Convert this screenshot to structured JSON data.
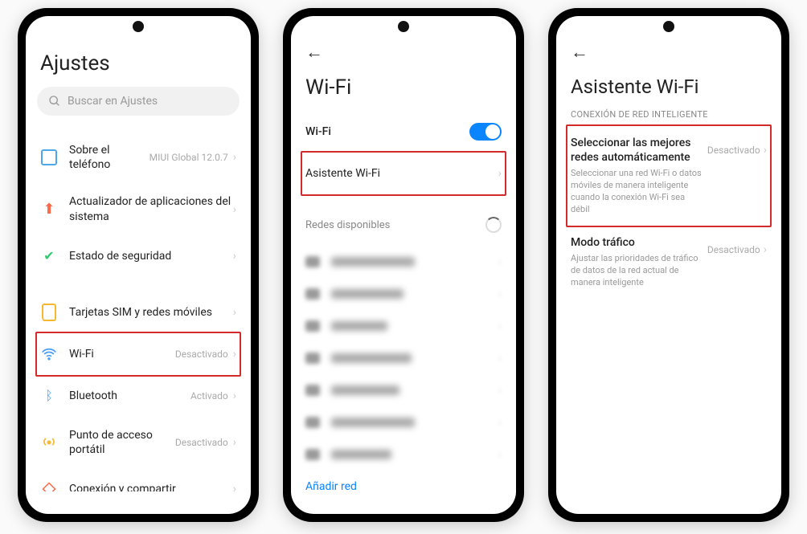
{
  "phone1": {
    "title": "Ajustes",
    "search_placeholder": "Buscar en Ajustes",
    "items": {
      "about": {
        "label": "Sobre el teléfono",
        "value": "MIUI Global 12.0.7"
      },
      "updater": {
        "label": "Actualizador de aplicaciones del sistema"
      },
      "security": {
        "label": "Estado de seguridad"
      },
      "sim": {
        "label": "Tarjetas SIM y redes móviles"
      },
      "wifi": {
        "label": "Wi-Fi",
        "value": "Desactivado"
      },
      "bluetooth": {
        "label": "Bluetooth",
        "value": "Activado"
      },
      "hotspot": {
        "label": "Punto de acceso portátil",
        "value": "Desactivado"
      },
      "share": {
        "label": "Conexión y compartir"
      }
    }
  },
  "phone2": {
    "title": "Wi-Fi",
    "toggle_label": "Wi-Fi",
    "assistant_label": "Asistente Wi-Fi",
    "networks_label": "Redes disponibles",
    "add_network": "Añadir red"
  },
  "phone3": {
    "title": "Asistente Wi-Fi",
    "section": "CONEXIÓN DE RED INTELIGENTE",
    "auto": {
      "title": "Seleccionar las mejores redes automáticamente",
      "desc": "Seleccionar una red Wi-Fi o datos móviles de manera inteligente cuando la conexión Wi-Fi sea débil",
      "value": "Desactivado"
    },
    "traffic": {
      "title": "Modo tráfico",
      "desc": "Ajustar las prioridades de tráfico de datos de la red actual de manera inteligente",
      "value": "Desactivado"
    }
  }
}
